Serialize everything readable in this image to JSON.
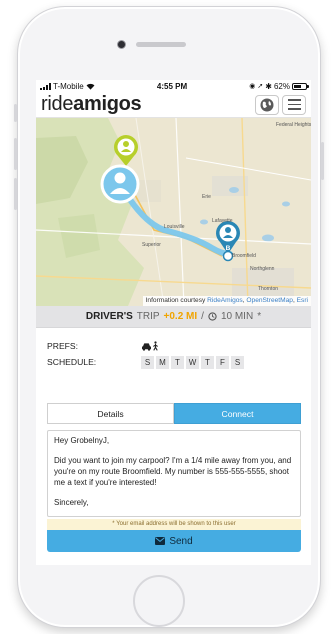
{
  "status_bar": {
    "carrier": "T-Mobile",
    "time": "4:55 PM",
    "battery_percent": "62%",
    "battery_level": 0.62
  },
  "header": {
    "logo_light": "ride",
    "logo_bold": "amigos",
    "globe_icon": "globe-icon",
    "menu_icon": "hamburger-menu-icon"
  },
  "map": {
    "place_labels": [
      "Erie",
      "Lafayette",
      "Louisville",
      "Superior",
      "Northglenn",
      "Thornton",
      "Broomfield",
      "Federal Heights"
    ],
    "end_marker_letter": "B",
    "credit_prefix": "Information courtesy",
    "credit_links": [
      "RideAmigos",
      "OpenStreetMap",
      "Esri"
    ]
  },
  "trip": {
    "role": "DRIVER'S",
    "label": "TRIP",
    "extra_distance": "+0.2 MI",
    "separator": "/",
    "extra_time": "10 MIN",
    "asterisk": "*"
  },
  "prefs": {
    "prefs_label": "PREFS:",
    "schedule_label": "SCHEDULE:",
    "pref_icons": [
      "car-icon",
      "walking-icon"
    ],
    "days": [
      "S",
      "M",
      "T",
      "W",
      "T",
      "F",
      "S"
    ]
  },
  "tabs": {
    "details": "Details",
    "connect": "Connect"
  },
  "message": {
    "greeting": "Hey GrobelnyJ,",
    "body": "Did you want to join my carpool? I'm a 1/4 mile away from you, and you're on my route Broomfield. My number is 555-555-5555, shoot me a text if you're interested!",
    "closing": "Sincerely,"
  },
  "email_note": "* Your email address will be shown to this user",
  "send_label": "Send",
  "colors": {
    "accent": "#45ace2",
    "pin_start": "#b7cf2b",
    "pin_end": "#2a87b5",
    "route": "#7cc7ec"
  }
}
